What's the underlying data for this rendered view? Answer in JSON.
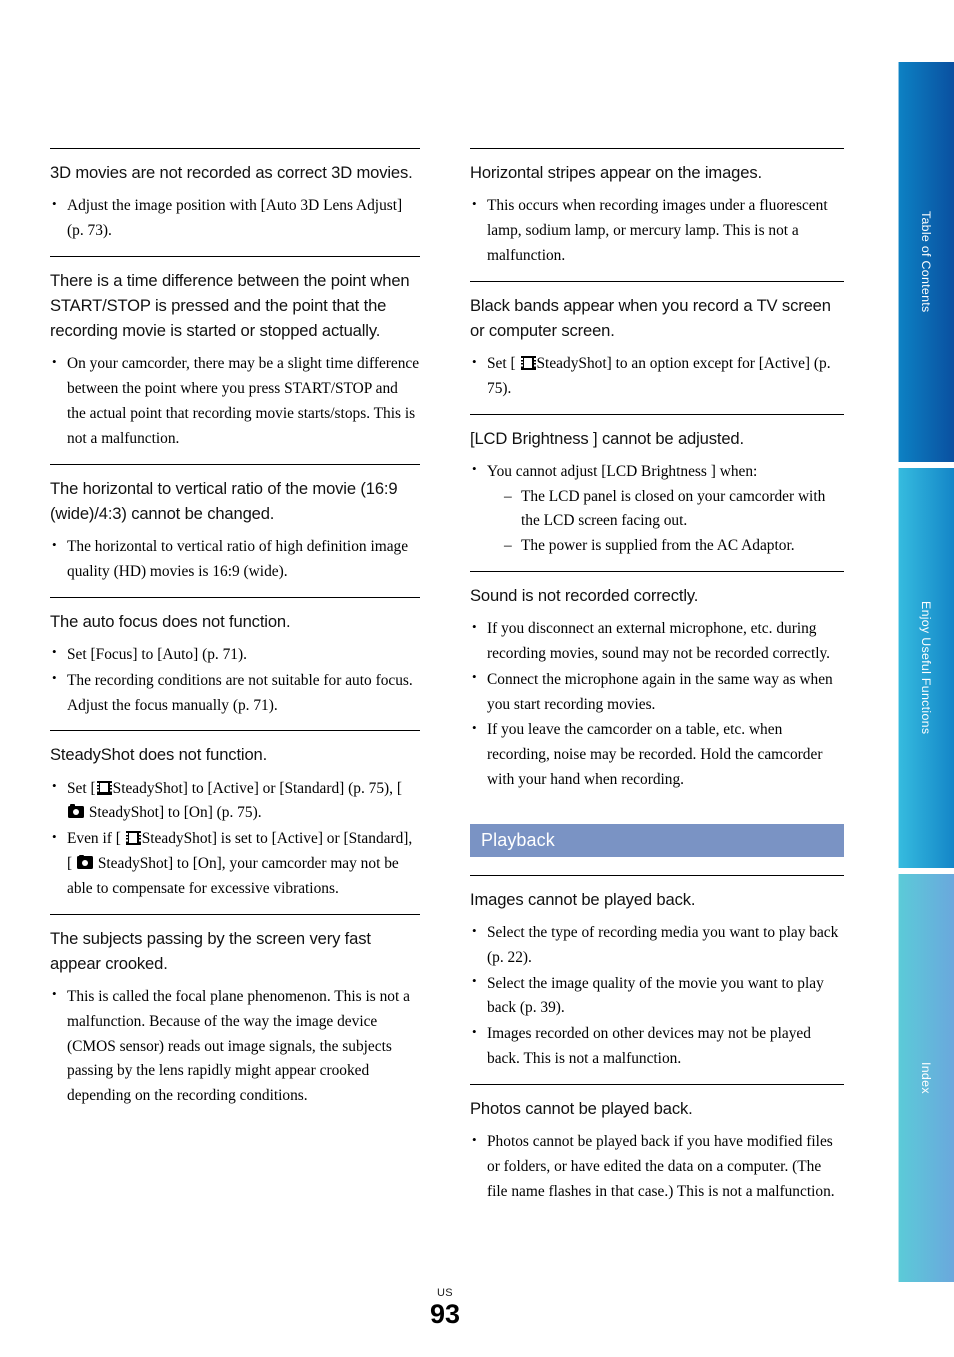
{
  "page": {
    "region": "US",
    "number": "93"
  },
  "left_column": {
    "sections": [
      {
        "title": "3D movies are not recorded as correct 3D movies.",
        "bullets": [
          {
            "text": "Adjust the image position with [Auto 3D Lens Adjust] (p. 73)."
          }
        ]
      },
      {
        "title": "There is a time difference between the point when START/STOP is pressed and the point that the recording movie is started or stopped actually.",
        "bullets": [
          {
            "text": "On your camcorder, there may be a slight time difference between the point where you press START/STOP and the actual point that recording movie starts/stops. This is not a malfunction."
          }
        ]
      },
      {
        "title": "The horizontal to vertical ratio of the movie (16:9 (wide)/4:3) cannot be changed.",
        "bullets": [
          {
            "text": "The horizontal to vertical ratio of high definition image quality (HD) movies is 16:9 (wide)."
          }
        ]
      },
      {
        "title": "The auto focus does not function.",
        "bullets": [
          {
            "text": "Set [Focus] to [Auto] (p. 71)."
          },
          {
            "text": "The recording conditions are not suitable for auto focus. Adjust the focus manually (p. 71)."
          }
        ]
      },
      {
        "title": "SteadyShot does not function.",
        "bullets": [
          {
            "segments": [
              {
                "type": "text",
                "value": "Set ["
              },
              {
                "type": "icon",
                "value": "movie-icon"
              },
              {
                "type": "text",
                "value": "SteadyShot] to [Active] or [Standard] (p. 75), [ "
              },
              {
                "type": "icon",
                "value": "photo-icon"
              },
              {
                "type": "text",
                "value": " SteadyShot] to [On] (p. 75)."
              }
            ]
          },
          {
            "segments": [
              {
                "type": "text",
                "value": "Even if [ "
              },
              {
                "type": "icon",
                "value": "movie-icon"
              },
              {
                "type": "text",
                "value": "SteadyShot] is set to [Active] or [Standard], [ "
              },
              {
                "type": "icon",
                "value": "photo-icon"
              },
              {
                "type": "text",
                "value": " SteadyShot] to [On], your camcorder may not be able to compensate for excessive vibrations."
              }
            ]
          }
        ]
      },
      {
        "title": "The subjects passing by the screen very fast appear crooked.",
        "bullets": [
          {
            "text": "This is called the focal plane phenomenon. This is not a malfunction. Because of the way the image device (CMOS sensor) reads out image signals, the subjects passing by the lens rapidly might appear crooked depending on the recording conditions."
          }
        ]
      }
    ]
  },
  "right_column": {
    "sections_top": [
      {
        "title": "Horizontal stripes appear on the images.",
        "bullets": [
          {
            "text": "This occurs when recording images under a fluorescent lamp, sodium lamp, or mercury lamp. This is not a malfunction."
          }
        ]
      },
      {
        "title": "Black bands appear when you record a TV screen or computer screen.",
        "bullets": [
          {
            "segments": [
              {
                "type": "text",
                "value": "Set [ "
              },
              {
                "type": "icon",
                "value": "movie-icon"
              },
              {
                "type": "text",
                "value": "SteadyShot] to an option except for [Active] (p. 75)."
              }
            ]
          }
        ]
      },
      {
        "title": "[LCD Brightness ] cannot be adjusted.",
        "bullets": [
          {
            "text": "You cannot adjust [LCD Brightness ] when:"
          }
        ],
        "sub_items": [
          "The LCD panel is closed on your camcorder with the LCD screen facing out.",
          "The power is supplied from the AC Adaptor."
        ]
      },
      {
        "title": "Sound is not recorded correctly.",
        "bullets": [
          {
            "text": "If you disconnect an external microphone, etc. during recording movies, sound may not be recorded correctly."
          },
          {
            "text": "Connect the microphone again in the same way as when you start recording movies."
          },
          {
            "text": "If you leave the camcorder on a table, etc. when recording, noise may be recorded. Hold the camcorder with your hand when recording."
          }
        ]
      }
    ],
    "band": {
      "label": "Playback",
      "color": "#7a93c4"
    },
    "sections_bottom": [
      {
        "title": "Images cannot be played back.",
        "bullets": [
          {
            "text": "Select the type of recording media you want to play back (p. 22)."
          },
          {
            "text": "Select the image quality of the movie you want to play back (p. 39)."
          },
          {
            "text": "Images recorded on other devices may not be played back. This is not a malfunction."
          }
        ]
      },
      {
        "title": "Photos cannot be played back.",
        "bullets": [
          {
            "text": "Photos cannot be played back if you have modified files or folders, or have edited the data on a computer. (The file name flashes in that case.) This is not a malfunction."
          }
        ]
      }
    ]
  },
  "side_tabs": [
    {
      "label": "Table of Contents",
      "color_from": "#0d82c4",
      "color_to": "#0a50a0"
    },
    {
      "label": "Enjoy Useful Functions",
      "color_from": "#36bcdf",
      "color_to": "#1486c8"
    },
    {
      "label": "Index",
      "color_from": "#5bcbd8",
      "color_to": "#6aa8dd"
    }
  ]
}
